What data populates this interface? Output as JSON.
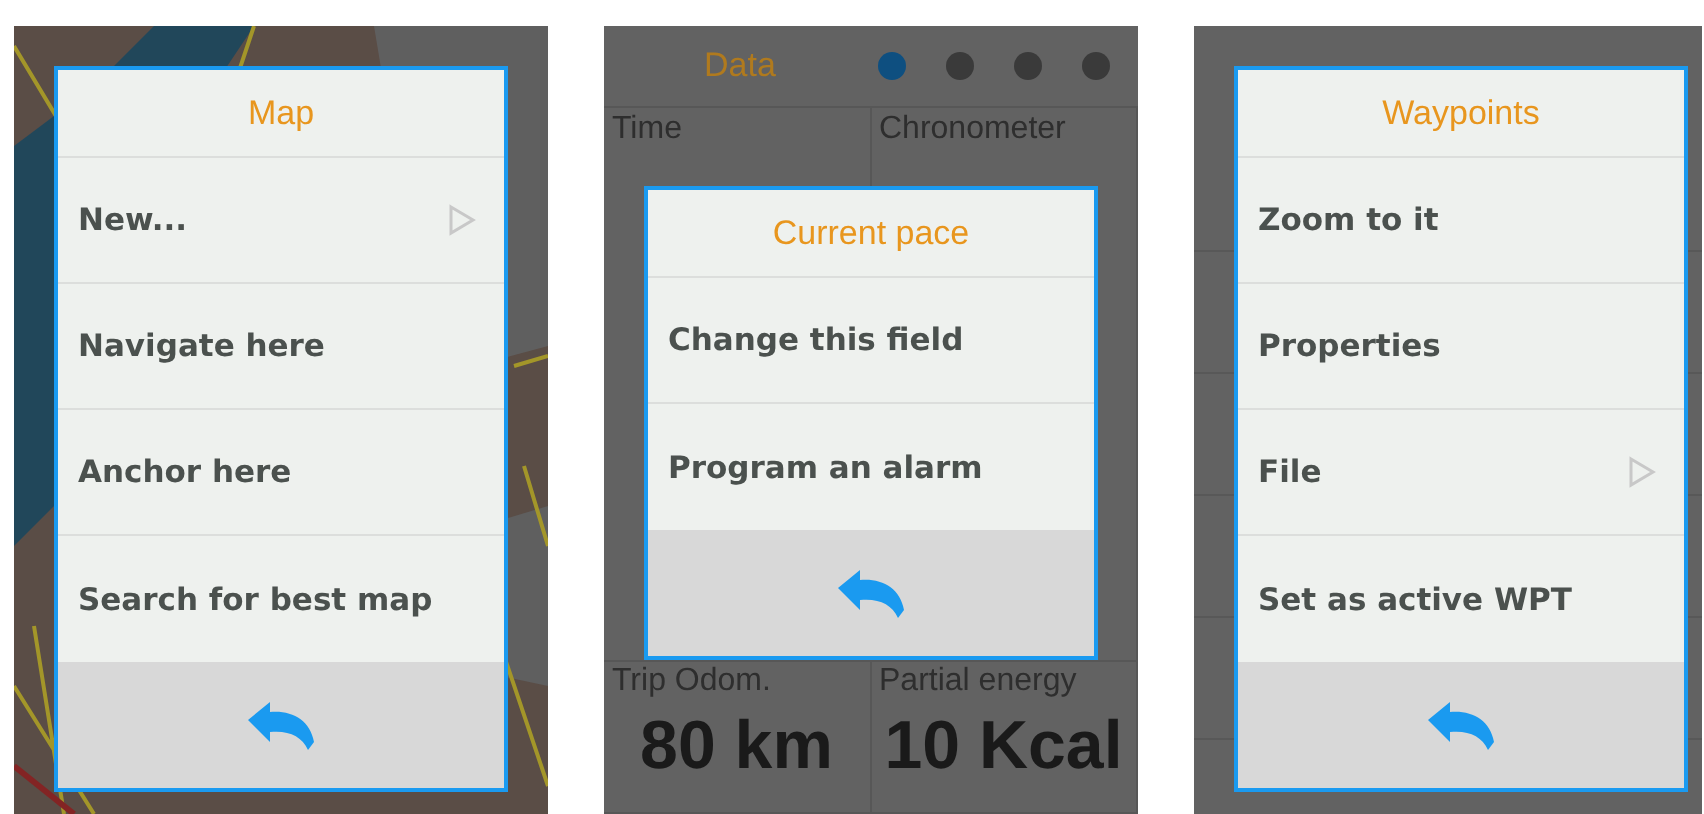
{
  "screens": [
    {
      "kind": "map",
      "dialog": {
        "title": "Map",
        "items": [
          {
            "label": "New...",
            "submenu": true
          },
          {
            "label": "Navigate here",
            "submenu": false
          },
          {
            "label": "Anchor here",
            "submenu": false
          },
          {
            "label": "Search for best map",
            "submenu": false
          }
        ]
      }
    },
    {
      "kind": "data",
      "background": {
        "title": "Data",
        "pages": [
          {
            "selected": true
          },
          {
            "selected": false
          },
          {
            "selected": false
          },
          {
            "selected": false
          }
        ],
        "cells": [
          {
            "label": "Time"
          },
          {
            "label": "Chronometer"
          },
          {
            "label": "Trip Odom.",
            "value": "80 km"
          },
          {
            "label": "Partial energy",
            "value": "10 Kcal"
          }
        ]
      },
      "dialog": {
        "title": "Current pace",
        "items": [
          {
            "label": "Change this field",
            "submenu": false
          },
          {
            "label": "Program an alarm",
            "submenu": false
          }
        ]
      }
    },
    {
      "kind": "list",
      "dialog": {
        "title": "Waypoints",
        "items": [
          {
            "label": "Zoom to it",
            "submenu": false
          },
          {
            "label": "Properties",
            "submenu": false
          },
          {
            "label": "File",
            "submenu": true
          },
          {
            "label": "Set as active WPT",
            "submenu": false
          }
        ]
      }
    }
  ]
}
